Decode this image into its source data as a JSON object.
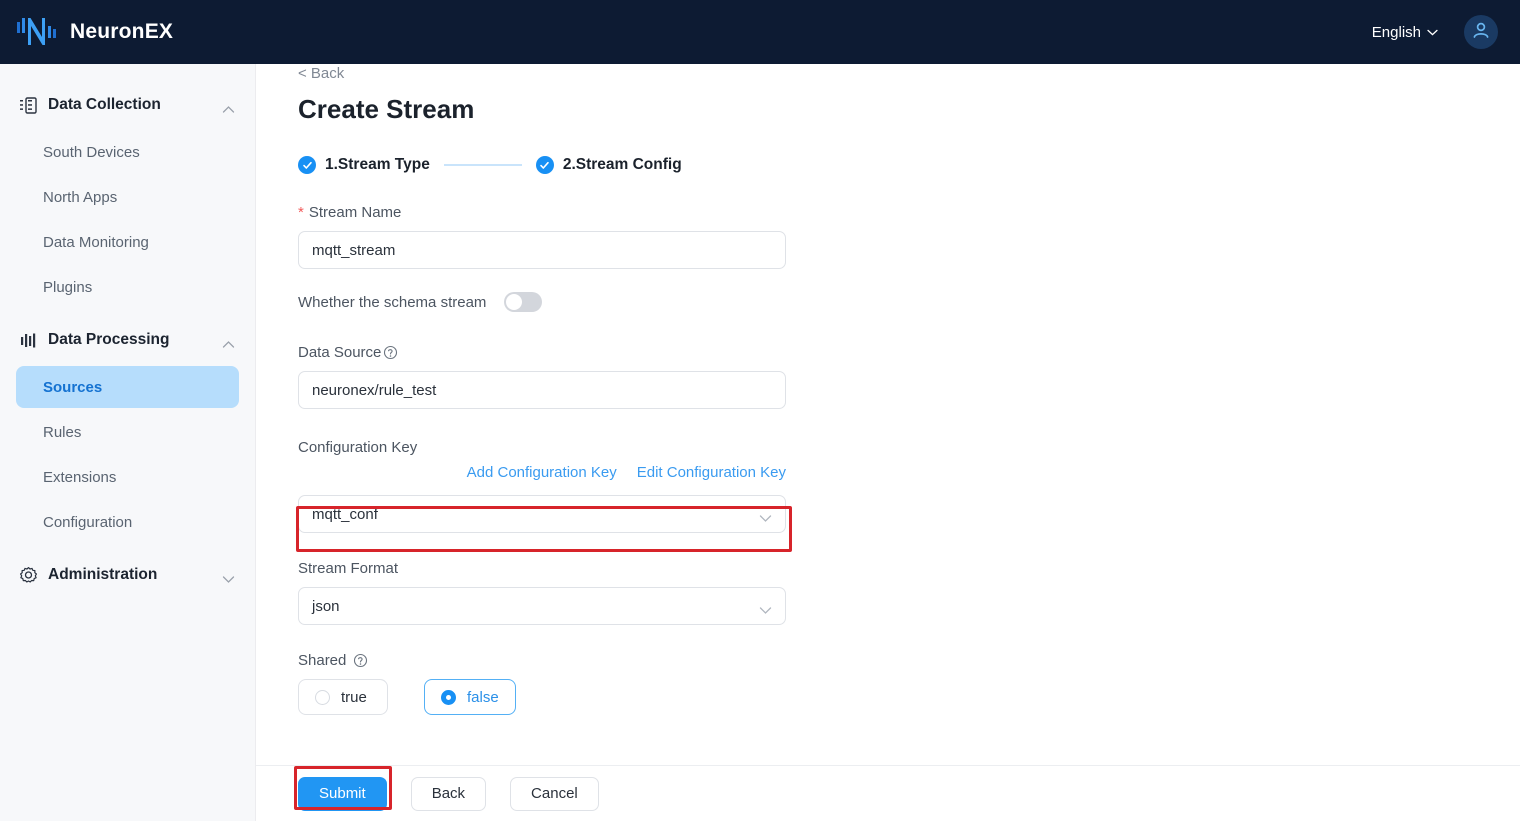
{
  "topbar": {
    "brand_name": "NeuronEX",
    "logo_icon": "neuronex-logo-icon",
    "language_label": "English",
    "language_chevron_icon": "chevron-down-icon",
    "avatar_icon": "user-avatar-icon",
    "bg_color": "#0d1b33"
  },
  "sidebar": {
    "groups": [
      {
        "label": "Data Collection",
        "icon": "data-collection-icon",
        "chevron": "chevron-up-icon",
        "expanded": true,
        "items": [
          {
            "label": "South Devices",
            "active": false
          },
          {
            "label": "North Apps",
            "active": false
          },
          {
            "label": "Data Monitoring",
            "active": false
          },
          {
            "label": "Plugins",
            "active": false
          }
        ]
      },
      {
        "label": "Data Processing",
        "icon": "data-processing-icon",
        "chevron": "chevron-up-icon",
        "expanded": true,
        "items": [
          {
            "label": "Sources",
            "active": true
          },
          {
            "label": "Rules",
            "active": false
          },
          {
            "label": "Extensions",
            "active": false
          },
          {
            "label": "Configuration",
            "active": false
          }
        ]
      },
      {
        "label": "Administration",
        "icon": "gear-icon",
        "chevron": "chevron-down-icon",
        "expanded": false,
        "items": []
      }
    ],
    "active_color": "#b6ddfc",
    "active_text_color": "#1472d1"
  },
  "main": {
    "back_label": "< Back",
    "page_title": "Create Stream",
    "stepper": {
      "steps": [
        {
          "label": "1.Stream Type",
          "done": true
        },
        {
          "label": "2.Stream Config",
          "done": true
        }
      ],
      "dot_color": "#1890f4",
      "line_color": "#c9e4fb"
    },
    "form": {
      "stream_name": {
        "label": "Stream Name",
        "required": true,
        "value": "mqtt_stream",
        "placeholder": ""
      },
      "schema_stream": {
        "label": "Whether the schema stream",
        "enabled": false
      },
      "data_source": {
        "label": "Data Source",
        "help_icon": "question-circle-icon",
        "value": "neuronex/rule_test",
        "placeholder": ""
      },
      "configuration_key": {
        "label": "Configuration Key",
        "add_link": "Add Configuration Key",
        "edit_link": "Edit Configuration Key",
        "value": "mqtt_conf",
        "chevron_icon": "chevron-down-icon",
        "highlighted": true
      },
      "stream_format": {
        "label": "Stream Format",
        "value": "json",
        "chevron_icon": "chevron-down-icon"
      },
      "shared": {
        "label": "Shared",
        "help_icon": "question-circle-icon",
        "options": [
          {
            "label": "true",
            "selected": false
          },
          {
            "label": "false",
            "selected": true
          }
        ]
      }
    },
    "footer": {
      "submit_label": "Submit",
      "back_label": "Back",
      "cancel_label": "Cancel",
      "submit_highlighted": true
    }
  },
  "highlight_color": "#d7242a",
  "accent_color": "#2196f3"
}
